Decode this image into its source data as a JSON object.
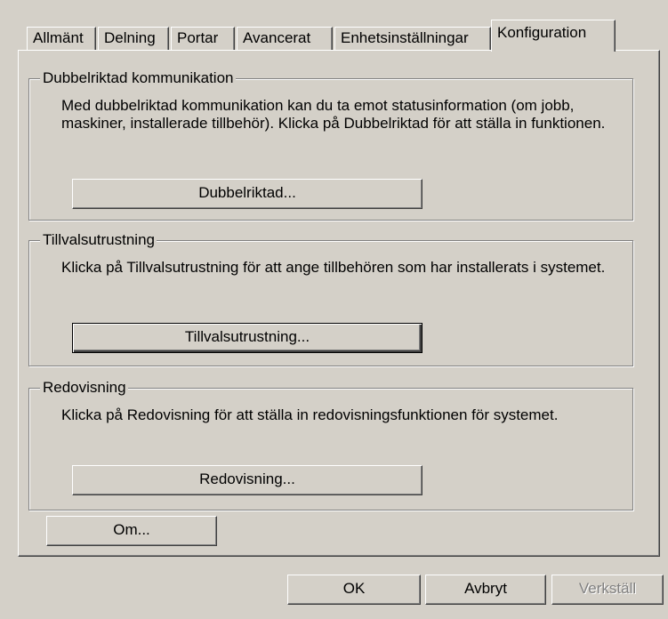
{
  "tabs": [
    {
      "label": "Allmänt",
      "active": false
    },
    {
      "label": "Delning",
      "active": false
    },
    {
      "label": "Portar",
      "active": false
    },
    {
      "label": "Avancerat",
      "active": false
    },
    {
      "label": "Enhetsinställningar",
      "active": false
    },
    {
      "label": "Konfiguration",
      "active": true
    }
  ],
  "groups": {
    "bidirectional": {
      "title": "Dubbelriktad kommunikation",
      "text": "Med dubbelriktad kommunikation kan du ta emot statusinformation (om jobb, maskiner, installerade tillbehör). Klicka på Dubbelriktad för att ställa in funktionen.",
      "button": "Dubbelriktad..."
    },
    "options": {
      "title": "Tillvalsutrustning",
      "text": "Klicka på Tillvalsutrustning för att ange tillbehören som har installerats i systemet.",
      "button": "Tillvalsutrustning..."
    },
    "accounting": {
      "title": "Redovisning",
      "text": "Klicka på Redovisning för att ställa in redovisningsfunktionen för systemet.",
      "button": "Redovisning..."
    }
  },
  "about_button": "Om...",
  "footer": {
    "ok": "OK",
    "cancel": "Avbryt",
    "apply": "Verkställ"
  }
}
